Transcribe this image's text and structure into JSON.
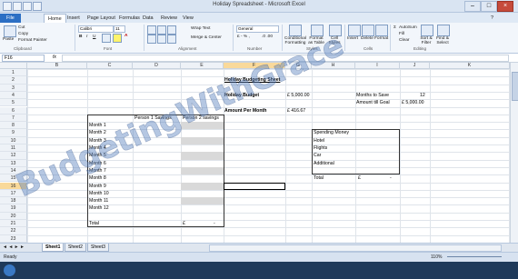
{
  "window": {
    "title": "Holiday Spreadsheet - Microsoft Excel"
  },
  "ribbon_tabs": [
    "File",
    "Home",
    "Insert",
    "Page Layout",
    "Formulas",
    "Data",
    "Review",
    "View"
  ],
  "ribbon": {
    "paste": "Paste",
    "cut": "Cut",
    "copy": "Copy",
    "format_painter": "Format Painter",
    "clipboard": "Clipboard",
    "font_name": "Calibri",
    "font_size": "11",
    "font": "Font",
    "bold": "B",
    "italic": "I",
    "underline": "U",
    "wrap_text": "Wrap Text",
    "merge_center": "Merge & Center",
    "alignment": "Alignment",
    "number_format": "General",
    "number": "Number",
    "conditional_formatting": "Conditional Formatting",
    "format_as_table": "Format as Table",
    "cell_styles": "Cell Styles",
    "styles": "Styles",
    "insert": "Insert",
    "delete": "Delete",
    "format": "Format",
    "cells": "Cells",
    "autosum": "AutoSum",
    "fill": "Fill",
    "clear": "Clear",
    "sort_filter": "Sort & Filter",
    "find_select": "Find & Select",
    "editing": "Editing"
  },
  "formula_bar": {
    "name_box": "F16",
    "fx": "fx",
    "value": ""
  },
  "columns": [
    "A",
    "B",
    "C",
    "D",
    "E",
    "F",
    "G",
    "H",
    "I",
    "J",
    "K"
  ],
  "rows": [
    "1",
    "2",
    "3",
    "4",
    "5",
    "6",
    "7",
    "8",
    "9",
    "10",
    "11",
    "12",
    "13",
    "14",
    "15",
    "16",
    "17",
    "18",
    "19",
    "20",
    "21",
    "22",
    "23"
  ],
  "sheet": {
    "title": "Holiday Budgeting Sheet",
    "holiday_budget_label": "Holiday Budget",
    "holiday_budget_value": "£ 5,000.00",
    "amount_per_month_label": "Amount Per Month",
    "amount_per_month_value": "£   416.67",
    "months_to_save_label": "Months to Save",
    "months_to_save_value": "12",
    "amount_till_goal_label": "Amount till Goal",
    "amount_till_goal_value": "£  5,000.00",
    "savings_headers": [
      "Person 1 Savings",
      "Person 2 savings"
    ],
    "months": [
      "Month 1",
      "Month 2",
      "Month 3",
      "Month 4",
      "Month 5",
      "Month 6",
      "Month 7",
      "Month 8",
      "Month 9",
      "Month 10",
      "Month 11",
      "Month 12"
    ],
    "total_label": "Total",
    "total_currency": "£",
    "total_dash": "-",
    "spending_header": "Spending Money",
    "spending_items": [
      "Hotel",
      "Flights",
      "Car",
      "Additional"
    ],
    "spending_total_label": "Total",
    "spending_total_currency": "£",
    "spending_total_dash": "-"
  },
  "sheet_tabs": [
    "Sheet1",
    "Sheet2",
    "Sheet3"
  ],
  "status": {
    "ready": "Ready",
    "zoom": "110%"
  },
  "watermark": "BudgetingWithGrace"
}
